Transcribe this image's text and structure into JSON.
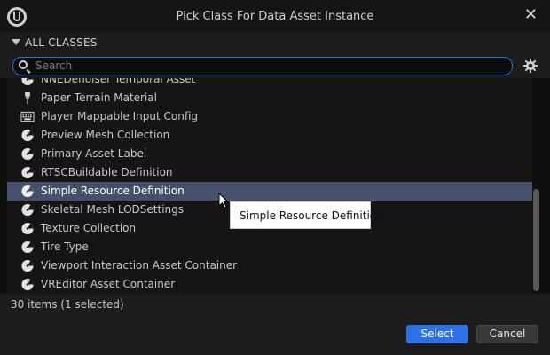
{
  "window": {
    "title": "Pick Class For Data Asset Instance"
  },
  "header": {
    "label": "ALL CLASSES"
  },
  "search": {
    "placeholder": "Search"
  },
  "list": {
    "items": [
      {
        "label": "NNEDenoiser Temporal Asset",
        "icon": "data-asset-icon"
      },
      {
        "label": "Paper Terrain Material",
        "icon": "paper-terrain-icon"
      },
      {
        "label": "Player Mappable Input Config",
        "icon": "keyboard-icon"
      },
      {
        "label": "Preview Mesh Collection",
        "icon": "data-asset-icon"
      },
      {
        "label": "Primary Asset Label",
        "icon": "data-asset-icon"
      },
      {
        "label": "RTSCBuildable Definition",
        "icon": "data-asset-icon"
      },
      {
        "label": "Simple Resource Definition",
        "icon": "data-asset-icon",
        "selected": true
      },
      {
        "label": "Skeletal Mesh LODSettings",
        "icon": "data-asset-icon"
      },
      {
        "label": "Texture Collection",
        "icon": "data-asset-icon"
      },
      {
        "label": "Tire Type",
        "icon": "data-asset-icon"
      },
      {
        "label": "Viewport Interaction Asset Container",
        "icon": "data-asset-icon"
      },
      {
        "label": "VREditor Asset Container",
        "icon": "data-asset-icon"
      }
    ]
  },
  "tooltip": {
    "text": "Simple Resource Definition"
  },
  "status": {
    "text": "30 items (1 selected)"
  },
  "footer": {
    "select_label": "Select",
    "cancel_label": "Cancel"
  },
  "colors": {
    "accent": "#2f6fe8",
    "selection": "#44506c",
    "background": "#151515"
  }
}
